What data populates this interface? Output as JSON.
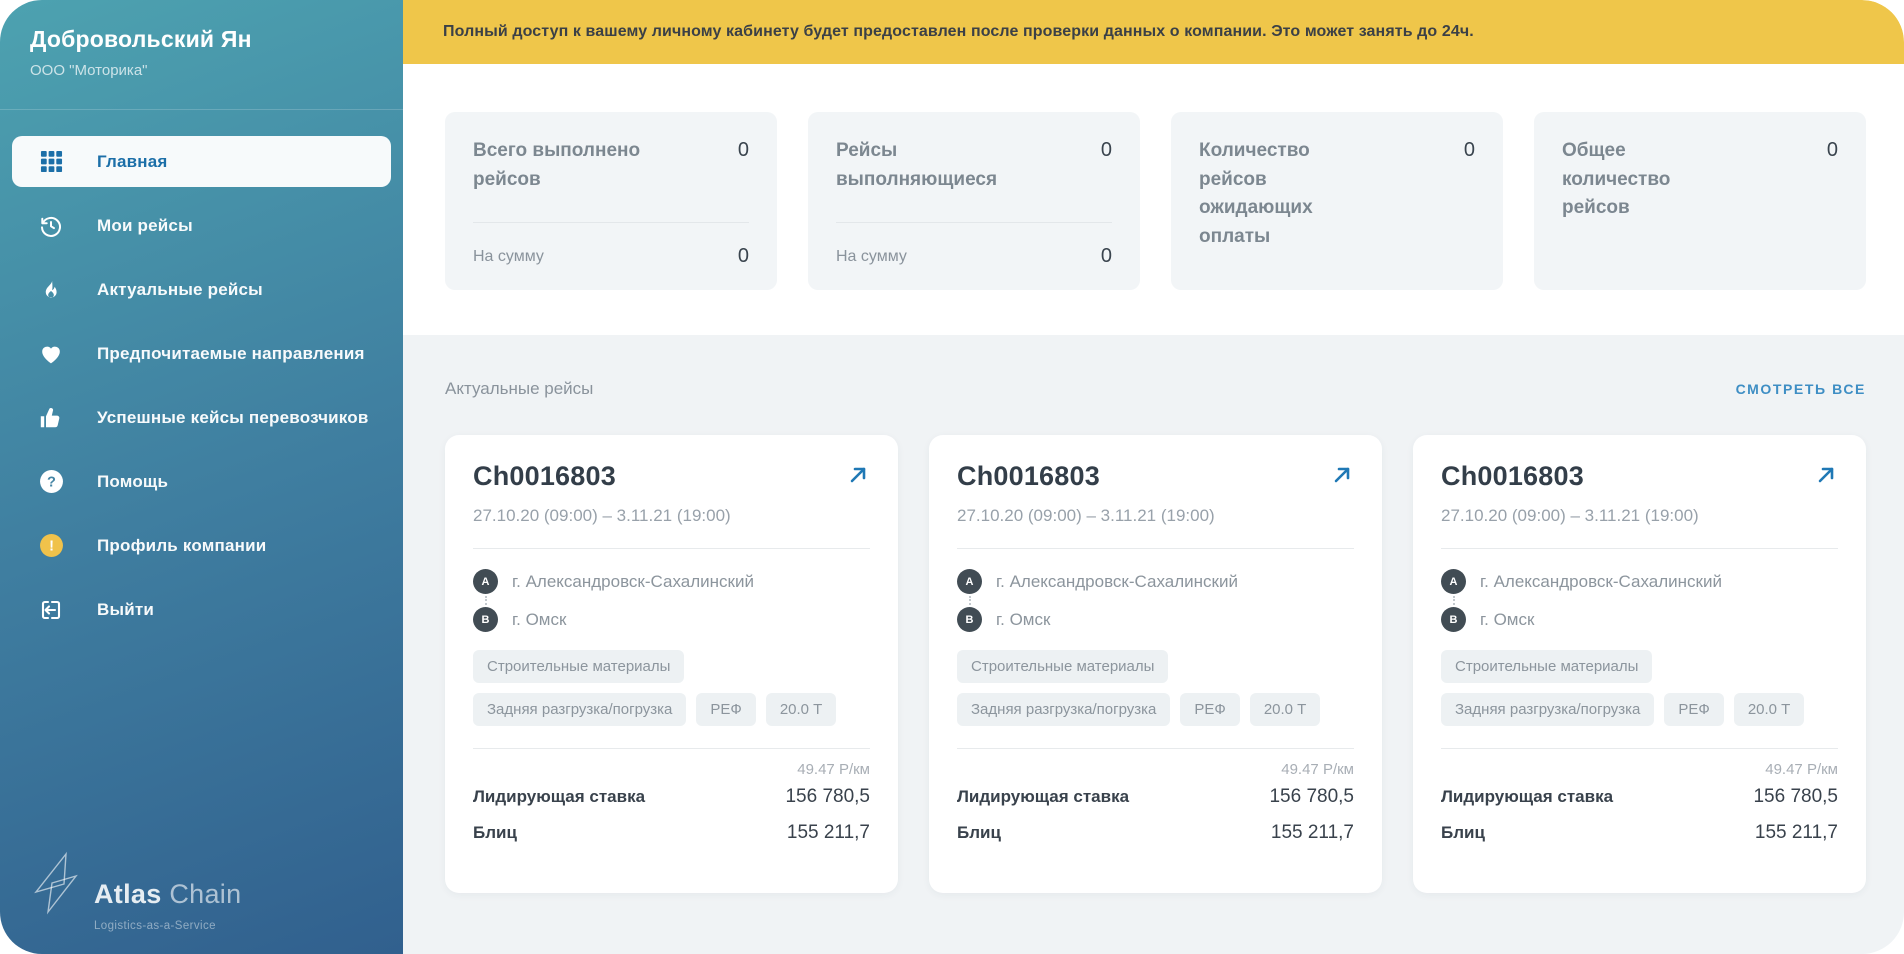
{
  "colors": {
    "sidebar_gradient_start": "#4DA2B0",
    "sidebar_gradient_end": "#31608E",
    "banner_bg": "#EFC64A",
    "accent_blue": "#1C6FA8",
    "link_blue": "#3E8EC4",
    "warning_yellow": "#F0C24B",
    "card_gray": "#F2F5F7",
    "section_gray": "#F0F3F5",
    "dark_text": "#333E49",
    "gray_text": "#8A939C"
  },
  "sidebar": {
    "user_name": "Добровольский Ян",
    "company": "ООО \"Моторика\"",
    "menu": [
      {
        "label": "Главная",
        "icon": "grid",
        "active": true
      },
      {
        "label": "Мои рейсы",
        "icon": "history",
        "active": false
      },
      {
        "label": "Актуальные рейсы",
        "icon": "flame",
        "active": false
      },
      {
        "label": "Предпочитаемые направления",
        "icon": "heart",
        "active": false
      },
      {
        "label": "Успешные кейсы перевозчиков",
        "icon": "thumbs-up",
        "active": false
      },
      {
        "label": "Помощь",
        "icon": "help-circle",
        "active": false
      },
      {
        "label": "Профиль компании",
        "icon": "warning-circle",
        "active": false
      },
      {
        "label": "Выйти",
        "icon": "logout",
        "active": false
      }
    ],
    "logo": {
      "title_bold": "Atlas",
      "title_light": "Chain",
      "tagline": "Logistics-as-a-Service"
    }
  },
  "banner": {
    "text": "Полный доступ к вашему личному кабинету будет предоставлен после проверки данных о компании. Это может занять до 24ч."
  },
  "stats": [
    {
      "title": "Всего выполнено рейсов",
      "value": "0",
      "sub_label": "На сумму",
      "sub_value": "0"
    },
    {
      "title": "Рейсы выполняющиеся",
      "value": "0",
      "sub_label": "На сумму",
      "sub_value": "0"
    },
    {
      "title": "Количество рейсов ожидающих оплаты",
      "value": "0"
    },
    {
      "title": "Общее количество рейсов",
      "value": "0"
    }
  ],
  "section": {
    "title": "Актуальные рейсы",
    "link": "СМОТРЕТЬ ВСЕ"
  },
  "rides": [
    {
      "id": "Ch0016803",
      "dates": "27.10.20 (09:00) – 3.11.21 (19:00)",
      "from_badge": "A",
      "from": "г. Александровск-Сахалинский",
      "to_badge": "B",
      "to": "г. Омск",
      "cargo_tag": "Строительные материалы",
      "tags": [
        "Задняя разгрузка/погрузка",
        "РЕФ",
        "20.0 Т"
      ],
      "rate_per_km": "49.47 Р/км",
      "leading_label": "Лидирующая ставка",
      "leading_value": "156 780,5",
      "blitz_label": "Блиц",
      "blitz_value": "155 211,7"
    },
    {
      "id": "Ch0016803",
      "dates": "27.10.20 (09:00) – 3.11.21 (19:00)",
      "from_badge": "A",
      "from": "г. Александровск-Сахалинский",
      "to_badge": "B",
      "to": "г. Омск",
      "cargo_tag": "Строительные материалы",
      "tags": [
        "Задняя разгрузка/погрузка",
        "РЕФ",
        "20.0 Т"
      ],
      "rate_per_km": "49.47 Р/км",
      "leading_label": "Лидирующая ставка",
      "leading_value": "156 780,5",
      "blitz_label": "Блиц",
      "blitz_value": "155 211,7"
    },
    {
      "id": "Ch0016803",
      "dates": "27.10.20 (09:00) – 3.11.21 (19:00)",
      "from_badge": "A",
      "from": "г. Александровск-Сахалинский",
      "to_badge": "B",
      "to": "г. Омск",
      "cargo_tag": "Строительные материалы",
      "tags": [
        "Задняя разгрузка/погрузка",
        "РЕФ",
        "20.0 Т"
      ],
      "rate_per_km": "49.47 Р/км",
      "leading_label": "Лидирующая ставка",
      "leading_value": "156 780,5",
      "blitz_label": "Блиц",
      "blitz_value": "155 211,7"
    }
  ]
}
